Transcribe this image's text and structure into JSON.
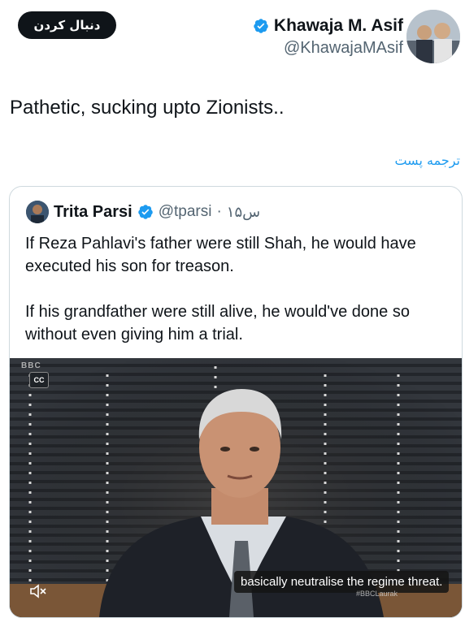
{
  "header": {
    "follow_label": "دنبال کردن",
    "author_name": "Khawaja M. Asif",
    "author_handle": "@KhawajaMAsif"
  },
  "tweet": {
    "text": "Pathetic, sucking upto  Zionists..",
    "translate_label": "ترجمه پست"
  },
  "quote": {
    "name": "Trita Parsi",
    "handle": "@tparsi",
    "separator": "·",
    "time": "۱۵س",
    "paragraph1": "If Reza Pahlavi's father were still Shah, he would have executed his son for treason.",
    "paragraph2": "If his grandfather were still alive, he would've done so without even giving him a trial."
  },
  "video": {
    "caption": "basically neutralise the regime threat.",
    "cc_label": "CC",
    "logo_text": "BBC",
    "watermark": "#BBCLaurak"
  },
  "colors": {
    "accent": "#1d9bf0",
    "text": "#0f1419",
    "muted": "#536471",
    "border": "#cfd9de"
  },
  "icons": {
    "verified": "verified-badge-icon",
    "mute": "speaker-mute-icon"
  }
}
